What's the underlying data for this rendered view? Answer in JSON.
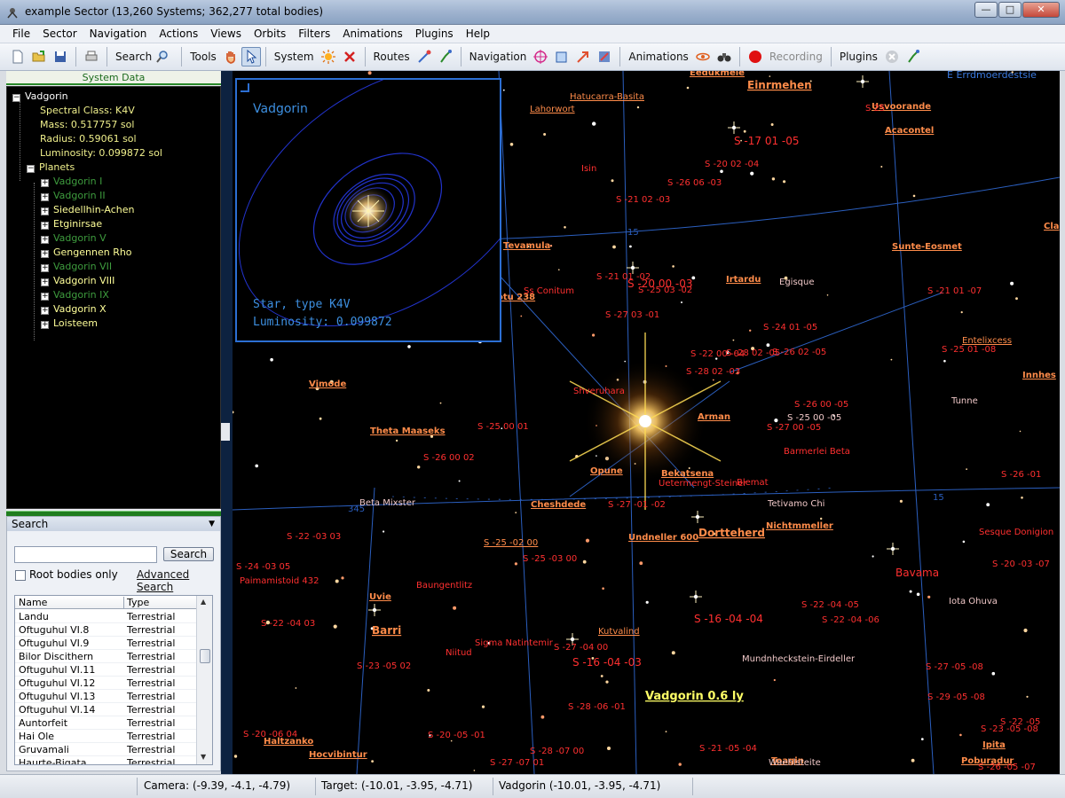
{
  "window": {
    "title": "example Sector (13,260 Systems; 362,277 total bodies)",
    "buttons": {
      "minimize": "—",
      "maximize": "□",
      "close": "✕"
    }
  },
  "menu": [
    "File",
    "Sector",
    "Navigation",
    "Actions",
    "Views",
    "Orbits",
    "Filters",
    "Animations",
    "Plugins",
    "Help"
  ],
  "toolbar": {
    "search": "Search",
    "tools": "Tools",
    "system": "System",
    "routes": "Routes",
    "navigation": "Navigation",
    "animations": "Animations",
    "recording": "Recording",
    "plugins": "Plugins"
  },
  "system_data": {
    "header": "System Data",
    "root": "Vadgorin",
    "props": [
      "Spectral Class: K4V",
      "Mass: 0.517757 sol",
      "Radius: 0.59061 sol",
      "Luminosity: 0.099872 sol"
    ],
    "planets_label": "Planets",
    "planets": [
      {
        "name": "Vadgorin I",
        "dim": true
      },
      {
        "name": "Vadgorin II",
        "dim": true
      },
      {
        "name": "Siedellhin-Achen",
        "dim": false
      },
      {
        "name": "Etginirsae",
        "dim": false
      },
      {
        "name": "Vadgorin V",
        "dim": true
      },
      {
        "name": "Gengennen Rho",
        "dim": false
      },
      {
        "name": "Vadgorin VII",
        "dim": true
      },
      {
        "name": "Vadgorin VIII",
        "dim": false
      },
      {
        "name": "Vadgorin IX",
        "dim": true
      },
      {
        "name": "Vadgorin X",
        "dim": false
      },
      {
        "name": "Loisteem",
        "dim": false
      }
    ]
  },
  "search": {
    "header": "Search",
    "button": "Search",
    "value": "",
    "root_only": "Root bodies only",
    "advanced": "Advanced Search",
    "columns": [
      "Name",
      "Type"
    ],
    "rows": [
      [
        "Landu",
        "Terrestrial"
      ],
      [
        "Oftuguhul VI.8",
        "Terrestrial"
      ],
      [
        "Oftuguhul VI.9",
        "Terrestrial"
      ],
      [
        "Bilor Discithern",
        "Terrestrial"
      ],
      [
        "Oftuguhul VI.11",
        "Terrestrial"
      ],
      [
        "Oftuguhul VI.12",
        "Terrestrial"
      ],
      [
        "Oftuguhul VI.13",
        "Terrestrial"
      ],
      [
        "Oftuguhul VI.14",
        "Terrestrial"
      ],
      [
        "Auntorfeit",
        "Terrestrial"
      ],
      [
        "Hai Ole",
        "Terrestrial"
      ],
      [
        "Gruvamali",
        "Terrestrial"
      ],
      [
        "Haurte-Bigata",
        "Terrestrial"
      ]
    ]
  },
  "infobox": {
    "name": "Vadgorin",
    "type": "Star, type K4V",
    "luminosity": "Luminosity: 0.099872"
  },
  "map": {
    "selected_label": "Vadgorin 0.6 ly",
    "grid_labels": [
      "15",
      "15",
      "345"
    ],
    "system_labels": [
      "Eedukmele",
      "Einrmehen",
      "E Errdmoerdestsie",
      "Hatucarra-Basita",
      "Lahorwort",
      "Usvoorande",
      "S 25",
      "S -17 01 -05",
      "Acacontel",
      "S -20 02 -04",
      "Isin",
      "S -26 06 -03",
      "S -21 02 -03",
      "Cla",
      "Tevamula",
      "Sunte-Eosmet",
      "S -21 01 -02",
      "S -20 00 -03",
      "Irtardu",
      "Egisque",
      "Ss Conitum",
      "otu 238",
      "S -25 03 -02",
      "S -21 01 -07",
      "S -27 03 -01",
      "S -24 01 -05",
      "Entelixcess",
      "S -25 01 -08",
      "S -26 02 -05",
      "S -22 00 -04",
      "S -28 02 -05",
      "S -28 02 -03",
      "Innhes",
      "Vimode",
      "Shveruhara",
      "S -26 00 -05",
      "Tunne",
      "Arman",
      "S -25 00 -05",
      "S -27 00 -05",
      "Theta Maaseks",
      "S -25 00 01",
      "Barmerlei Beta",
      "S -26 00 02",
      "Opune",
      "Bekatsena",
      "Uetermengt-Steiner",
      "Blemat",
      "S -26 -01",
      "Beta Mixster",
      "Cheshdede",
      "S -27 -01 -02",
      "Tetivamo Chi",
      "Nichtmmeller",
      "Dortteherd",
      "Undneller 600",
      "S -22 -03 03",
      "S -25 -02 00",
      "Sesque Donigion",
      "S -25 -03 00",
      "S -24 -03 05",
      "S -20 -03 -07",
      "Paimamistoid 432",
      "Baungentlitz",
      "Bavama",
      "Uvie",
      "S -22 -04 -05",
      "Iota Ohuva",
      "S -22 -04 03",
      "Barri",
      "Kutvalind",
      "S -16 -04 -04",
      "S -22 -04 -06",
      "Sigma Natintemir",
      "Niitud",
      "S -27 -04 00",
      "Mundnheckstein-Eirdeller",
      "S -23 -05 02",
      "S -16 -04 -03",
      "S -27 -05 -08",
      "S -29 -05 -08",
      "S -28 -06 -01",
      "S -22 -05",
      "S -23 -05 -08",
      "S -20 -06 04",
      "S -20 -05 -01",
      "Haltzanko",
      "Ipita",
      "Hocvibintur",
      "S -28 -07 00",
      "S -21 -05 -04",
      "Toagin",
      "Waehlsteite",
      "Poburadur",
      "S -27 -07 01",
      "S -26 -05 -07"
    ]
  },
  "status": {
    "camera": "Camera: (-9.39, -4.1, -4.79)",
    "target": "Target: (-10.01, -3.95, -4.71)",
    "selection": "Vadgorin (-10.01, -3.95, -4.71)"
  },
  "colors": {
    "label_orange": "#ff8c4a",
    "label_red": "#ff3030",
    "grid_blue": "#2b5fbf",
    "info_blue": "#3d8fe0",
    "selected_yellow": "#ffff66",
    "tree_green": "#3e9c3e"
  },
  "icons": {
    "new": "new-file-icon",
    "open": "open-folder-icon",
    "save": "save-disk-icon",
    "print": "printer-icon",
    "search": "magnifier-icon",
    "hand": "hand-icon",
    "pointer": "pointer-icon",
    "sun": "sun-icon",
    "close": "red-x-icon",
    "route": "route-icon",
    "target": "crosshair-icon",
    "record": "record-dot-icon"
  }
}
